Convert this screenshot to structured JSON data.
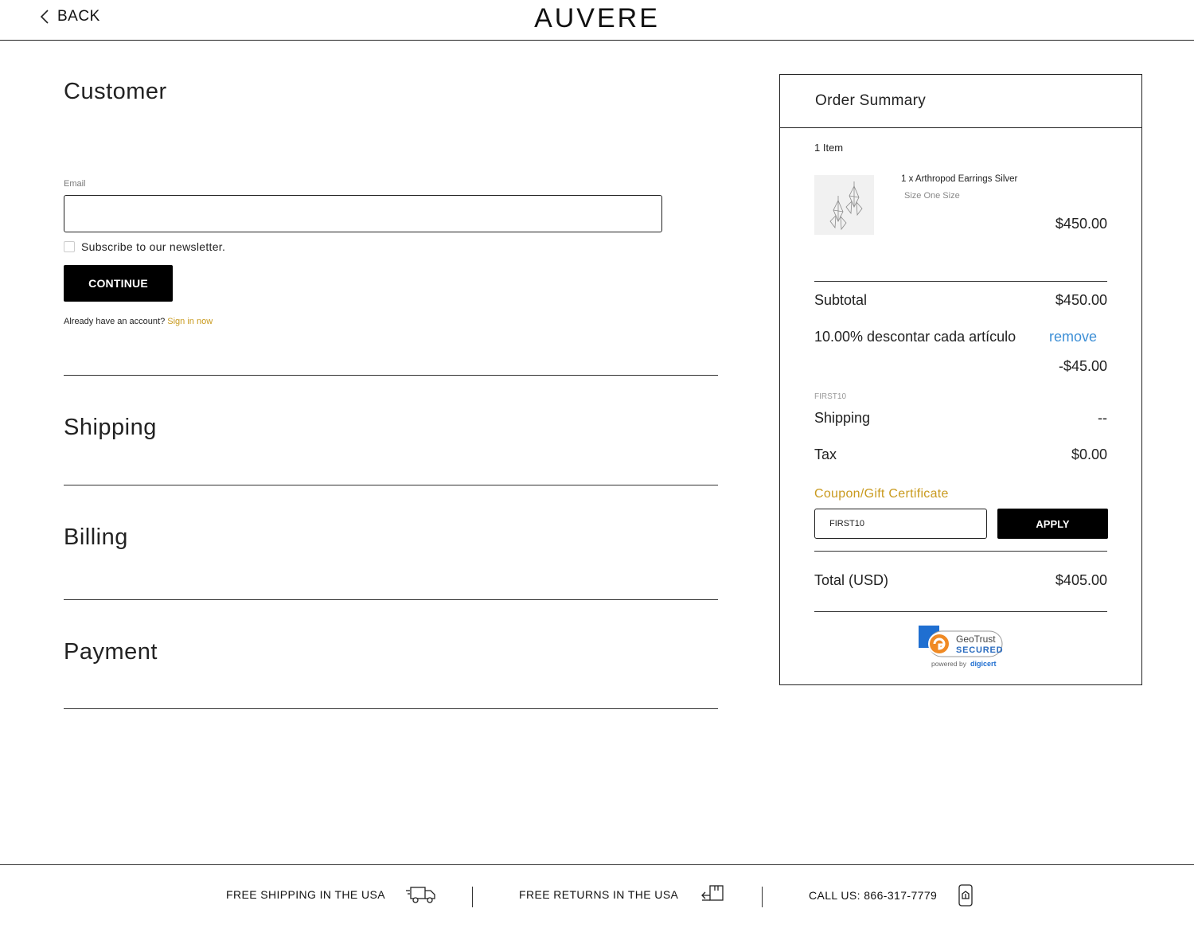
{
  "header": {
    "back_label": "BACK",
    "brand": "AUVERE"
  },
  "checkout": {
    "customer_title": "Customer",
    "email_label": "Email",
    "email_value": "",
    "newsletter_label": "Subscribe to our newsletter.",
    "newsletter_checked": false,
    "continue_label": "CONTINUE",
    "account_prompt": "Already have an account?",
    "sign_in_label": "Sign in now",
    "shipping_title": "Shipping",
    "billing_title": "Billing",
    "payment_title": "Payment"
  },
  "summary": {
    "title": "Order Summary",
    "item_count": "1 Item",
    "item": {
      "name": "1 x Arthropod Earrings Silver",
      "size": "Size One Size",
      "price": "$450.00"
    },
    "subtotal_label": "Subtotal",
    "subtotal_value": "$450.00",
    "discount_label": "10.00% descontar cada artículo",
    "remove_label": "remove",
    "discount_value": "-$45.00",
    "discount_code": "FIRST10",
    "shipping_label": "Shipping",
    "shipping_value": "--",
    "tax_label": "Tax",
    "tax_value": "$0.00",
    "coupon_label": "Coupon/Gift Certificate",
    "coupon_value": "FIRST10",
    "apply_label": "APPLY",
    "total_label": "Total (USD)",
    "total_value": "$405.00",
    "badge_title": "GeoTrust",
    "badge_subtitle": "SECURED",
    "badge_powered": "powered by",
    "badge_brand": "digicert"
  },
  "footer": {
    "shipping_text": "FREE SHIPPING  IN THE USA",
    "returns_text": "FREE RETURNS  IN THE USA",
    "call_text": "CALL US: 866-317-7779"
  },
  "colors": {
    "accent_gold": "#c99a1e",
    "link_blue": "#3d8fd6",
    "button_black": "#000000"
  }
}
